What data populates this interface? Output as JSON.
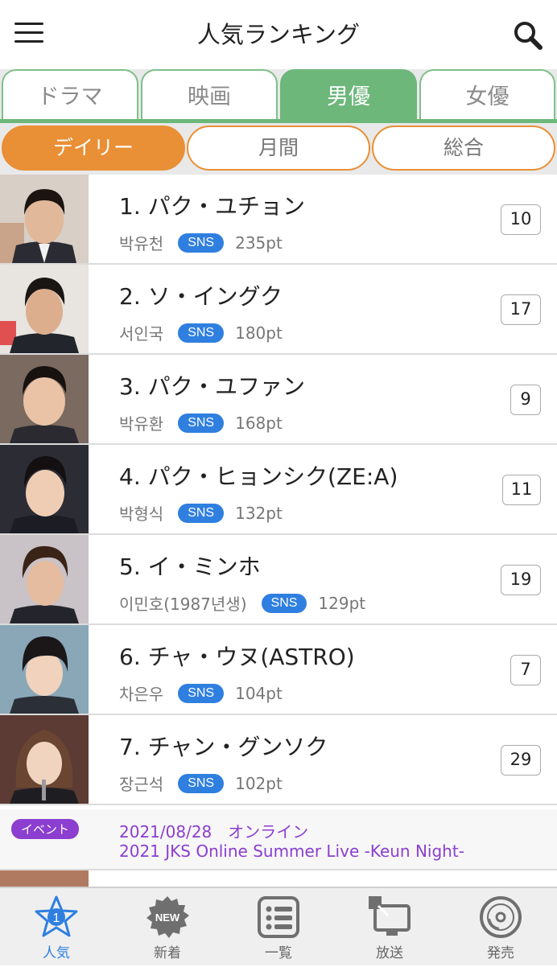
{
  "header": {
    "title": "人気ランキング",
    "menu_icon": "hamburger-icon",
    "search_icon": "search-icon"
  },
  "tabs": [
    {
      "label": "ドラマ",
      "active": false
    },
    {
      "label": "映画",
      "active": false
    },
    {
      "label": "男優",
      "active": true
    },
    {
      "label": "女優",
      "active": false
    }
  ],
  "periods": [
    {
      "label": "デイリー",
      "active": true
    },
    {
      "label": "月間",
      "active": false
    },
    {
      "label": "総合",
      "active": false
    }
  ],
  "sns_label": "SNS",
  "rankings": [
    {
      "name": "1. パク・ユチョン",
      "korean": "박유천",
      "points": "235pt",
      "count": "10"
    },
    {
      "name": "2. ソ・イングク",
      "korean": "서인국",
      "points": "180pt",
      "count": "17"
    },
    {
      "name": "3. パク・ユファン",
      "korean": "박유환",
      "points": "168pt",
      "count": "9"
    },
    {
      "name": "4. パク・ヒョンシク(ZE:A)",
      "korean": "박형식",
      "points": "132pt",
      "count": "11"
    },
    {
      "name": "5. イ・ミンホ",
      "korean": "이민호(1987년생)",
      "points": "129pt",
      "count": "19"
    },
    {
      "name": "6. チャ・ウヌ(ASTRO)",
      "korean": "차은우",
      "points": "104pt",
      "count": "7"
    },
    {
      "name": "7. チャン・グンソク",
      "korean": "장근석",
      "points": "102pt",
      "count": "29"
    }
  ],
  "event": {
    "badge": "イベント",
    "line1": "2021/08/28　オンライン",
    "line2": "2021 JKS Online Summer Live -Keun Night-"
  },
  "bottom_nav": [
    {
      "label": "人気",
      "icon": "star-rank-icon",
      "badge": "1",
      "active": true
    },
    {
      "label": "新着",
      "icon": "new-badge-icon",
      "badge": "NEW",
      "active": false
    },
    {
      "label": "一覧",
      "icon": "list-icon",
      "active": false
    },
    {
      "label": "放送",
      "icon": "broadcast-icon",
      "active": false
    },
    {
      "label": "発売",
      "icon": "disc-icon",
      "active": false
    }
  ],
  "colors": {
    "tab_green": "#6db77b",
    "segment_orange": "#e98f35",
    "sns_blue": "#2f7fe0",
    "event_purple": "#8b3ecf"
  }
}
